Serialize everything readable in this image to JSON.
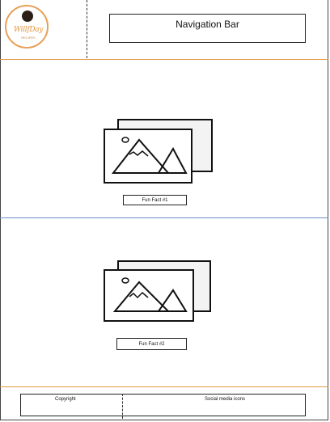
{
  "header": {
    "logo": {
      "text": "WillfDay",
      "subtext": "RECIPES"
    },
    "nav_label": "Navigation Bar"
  },
  "sections": [
    {
      "image_icon": "image-placeholder-icon",
      "caption": "Fun Fact #1"
    },
    {
      "image_icon": "image-placeholder-icon",
      "caption": "Fun Fact #2"
    }
  ],
  "footer": {
    "copyright_label": "Copyright",
    "social_label": "Social media icons"
  },
  "colors": {
    "accent_orange": "#e09a45",
    "divider_blue": "#6c8fc8"
  }
}
